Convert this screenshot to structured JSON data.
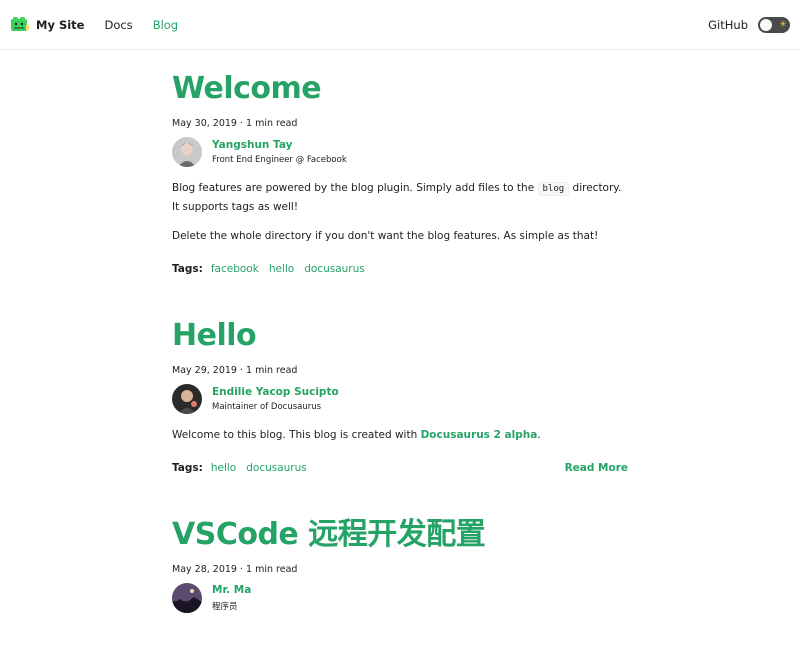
{
  "navbar": {
    "brand_title": "My Site",
    "links": [
      "Docs",
      "Blog"
    ],
    "active_link": "Blog",
    "github_label": "GitHub",
    "theme_icon": "sun-icon",
    "colors": {
      "accent": "#25a366",
      "toggle_bg": "#4a4a4a"
    }
  },
  "posts": [
    {
      "title": "Welcome",
      "meta": "May 30, 2019 · 1 min read",
      "author": {
        "name": "Yangshun Tay",
        "title": "Front End Engineer @ Facebook"
      },
      "body": {
        "p1_before": "Blog features are powered by the blog plugin. Simply add files to the ",
        "p1_code": "blog",
        "p1_after": " directory. It supports tags as well!",
        "p2": "Delete the whole directory if you don't want the blog features. As simple as that!"
      },
      "tags_label": "Tags:",
      "tags": [
        "facebook",
        "hello",
        "docusaurus"
      ]
    },
    {
      "title": "Hello",
      "meta": "May 29, 2019 · 1 min read",
      "author": {
        "name": "Endilie Yacop Sucipto",
        "title": "Maintainer of Docusaurus"
      },
      "body": {
        "p1_before": "Welcome to this blog. This blog is created with ",
        "p1_link": "Docusaurus 2 alpha",
        "p1_after": "."
      },
      "tags_label": "Tags:",
      "tags": [
        "hello",
        "docusaurus"
      ],
      "read_more": "Read More"
    },
    {
      "title": "VSCode 远程开发配置",
      "meta": "May 28, 2019 · 1 min read",
      "author": {
        "name": "Mr. Ma",
        "title": "程序员"
      }
    }
  ]
}
